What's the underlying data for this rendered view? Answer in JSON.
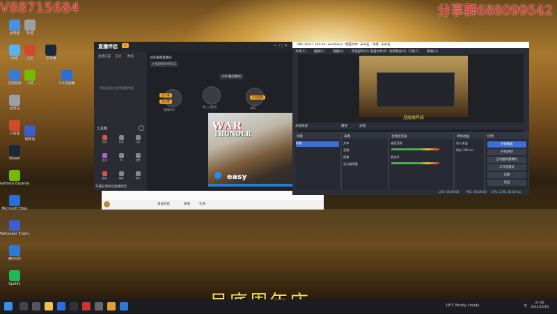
{
  "overlay": {
    "top_left": "V88715684",
    "top_right": "分享群688099542",
    "caption": "月底周年庆"
  },
  "desktop": {
    "icons_left": [
      "此电脑",
      "网络",
      "控制面板",
      "回收站",
      "小黑盒",
      "Steam",
      "GeForce Experience",
      "Microsoft Edge",
      "Wallpaper Engine",
      "腾讯QQ",
      "Spotify"
    ],
    "icons_col2": [
      "新建",
      "迅雷",
      "加速器",
      "火绒",
      "UU加速器",
      "网易云"
    ]
  },
  "live_window": {
    "logo": "直播伴侣",
    "nav_tabs": [
      "直播设置",
      "互动",
      "数据"
    ],
    "note": "请先登录以启用直播功能",
    "header_title": "战争雷霆直播间",
    "header_chip": "分享群688099542",
    "mode": "OBS推流模式",
    "nodes": [
      {
        "label": "直播伴侣"
      },
      {
        "label": "第三方推流"
      },
      {
        "label": "OBS"
      }
    ],
    "pills": [
      "去下载",
      "去设置",
      "开始直播"
    ],
    "tools_title": "工具箱",
    "tools": [
      "特效",
      "礼物",
      "公告",
      "连线",
      "PK",
      "投票",
      "抽奖",
      "福袋",
      "更多"
    ],
    "bottom_note": "开播前请阅读直播规范",
    "preview": {
      "title_top": "WAR",
      "title_bottom": "THUNDER",
      "brand": "easy"
    }
  },
  "chatbar": {
    "items": [
      "发送消息",
      "表情",
      "礼物"
    ]
  },
  "obs_window": {
    "title": "OBS 28.0.1 (64-bit, windows) - 配置文件: 未命名 - 场景: 未命名",
    "menu": [
      "文件(F)",
      "编辑(E)",
      "视图(V)",
      "停靠部件(D)",
      "配置文件(P)",
      "场景集合(S)",
      "工具(T)",
      "帮助(H)"
    ],
    "scene_caption": "月底周年庆",
    "tabs": [
      "未选择源",
      "属性",
      "滤镜"
    ],
    "docks": {
      "scenes": {
        "title": "场景",
        "items": [
          "场景"
        ]
      },
      "sources": {
        "title": "来源",
        "items": [
          "文本",
          "音频",
          "图像",
          "显示器采集"
        ]
      },
      "mixer": {
        "title": "音频混音器",
        "items": [
          "桌面音频",
          "麦克风"
        ]
      },
      "transitions": {
        "title": "转场动画",
        "items": [
          "淡入淡出",
          "时长 300 ms"
        ]
      },
      "controls": {
        "title": "控制",
        "items": [
          "开始推流",
          "开始录制",
          "启动虚拟摄像机",
          "工作室模式",
          "设置",
          "退出"
        ]
      }
    },
    "status": [
      "LIVE: 00:00:00",
      "REC: 00:00:00",
      "CPU: 2.0%, 60.00 fps"
    ]
  },
  "taskbar": {
    "tray_weather": "19°C  Mostly cloudy",
    "time": "21:06",
    "date": "2022/10/18",
    "lang": "中"
  }
}
